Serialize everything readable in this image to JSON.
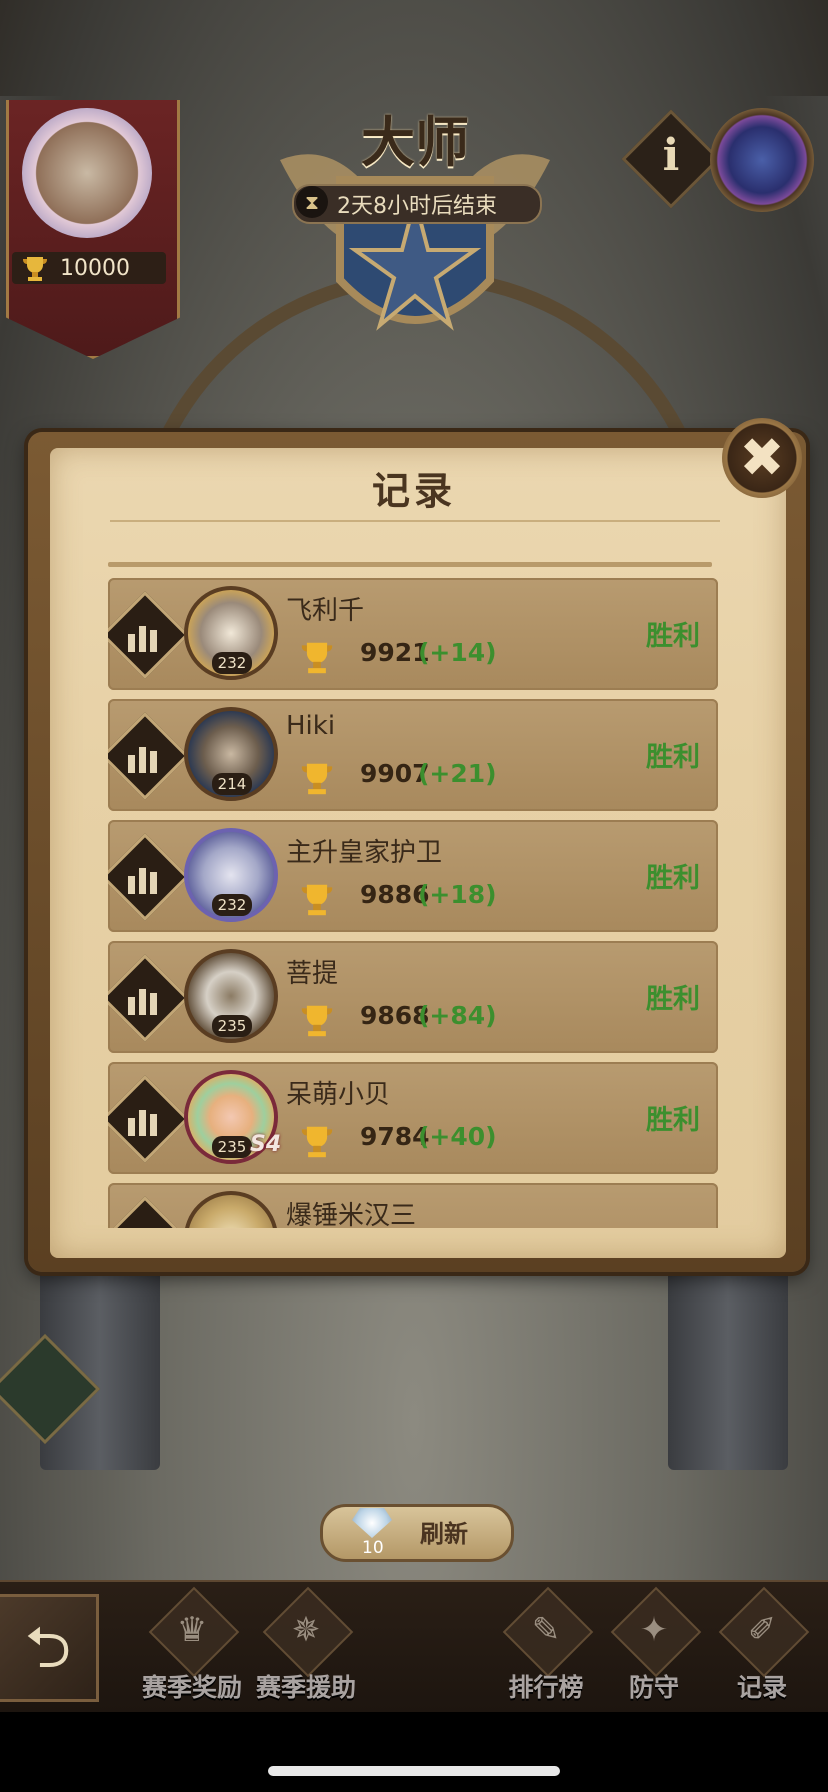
{
  "header": {
    "rank_title": "大师",
    "season_timer": "2天8小时后结束",
    "info_label": "i"
  },
  "player": {
    "trophies": "10000"
  },
  "modal": {
    "title": "记录",
    "close_label": "✖",
    "records": [
      {
        "name": "飞利千",
        "level": "232",
        "score": "9921",
        "delta": "(+14)",
        "result": "胜利",
        "avatar_color": "#c8a25a"
      },
      {
        "name": "Hiki",
        "level": "214",
        "score": "9907",
        "delta": "(+21)",
        "result": "胜利",
        "avatar_color": "#5b5a5f"
      },
      {
        "name": "主升皇家护卫",
        "level": "232",
        "score": "9886",
        "delta": "(+18)",
        "result": "胜利",
        "avatar_color": "#8f93c8"
      },
      {
        "name": "菩提",
        "level": "235",
        "score": "9868",
        "delta": "(+84)",
        "result": "胜利",
        "avatar_color": "#6b5a46"
      },
      {
        "name": "呆萌小贝",
        "level": "235",
        "score": "9784",
        "delta": "(+40)",
        "result": "胜利",
        "avatar_color": "#d9b26a"
      },
      {
        "name": "爆锤米汉三",
        "level": "",
        "score": "",
        "delta": "",
        "result": "",
        "avatar_color": "#b59a62"
      }
    ],
    "extra_badge": "S4"
  },
  "refresh": {
    "label": "刷新",
    "cost": "10"
  },
  "bottom_nav": {
    "season_rewards": "赛季奖励",
    "season_support": "赛季援助",
    "leaderboard": "排行榜",
    "defense": "防守",
    "records": "记录"
  },
  "colors": {
    "win": "#3c8f2e",
    "panel": "#e7d1a6",
    "row": "#b89b70"
  }
}
